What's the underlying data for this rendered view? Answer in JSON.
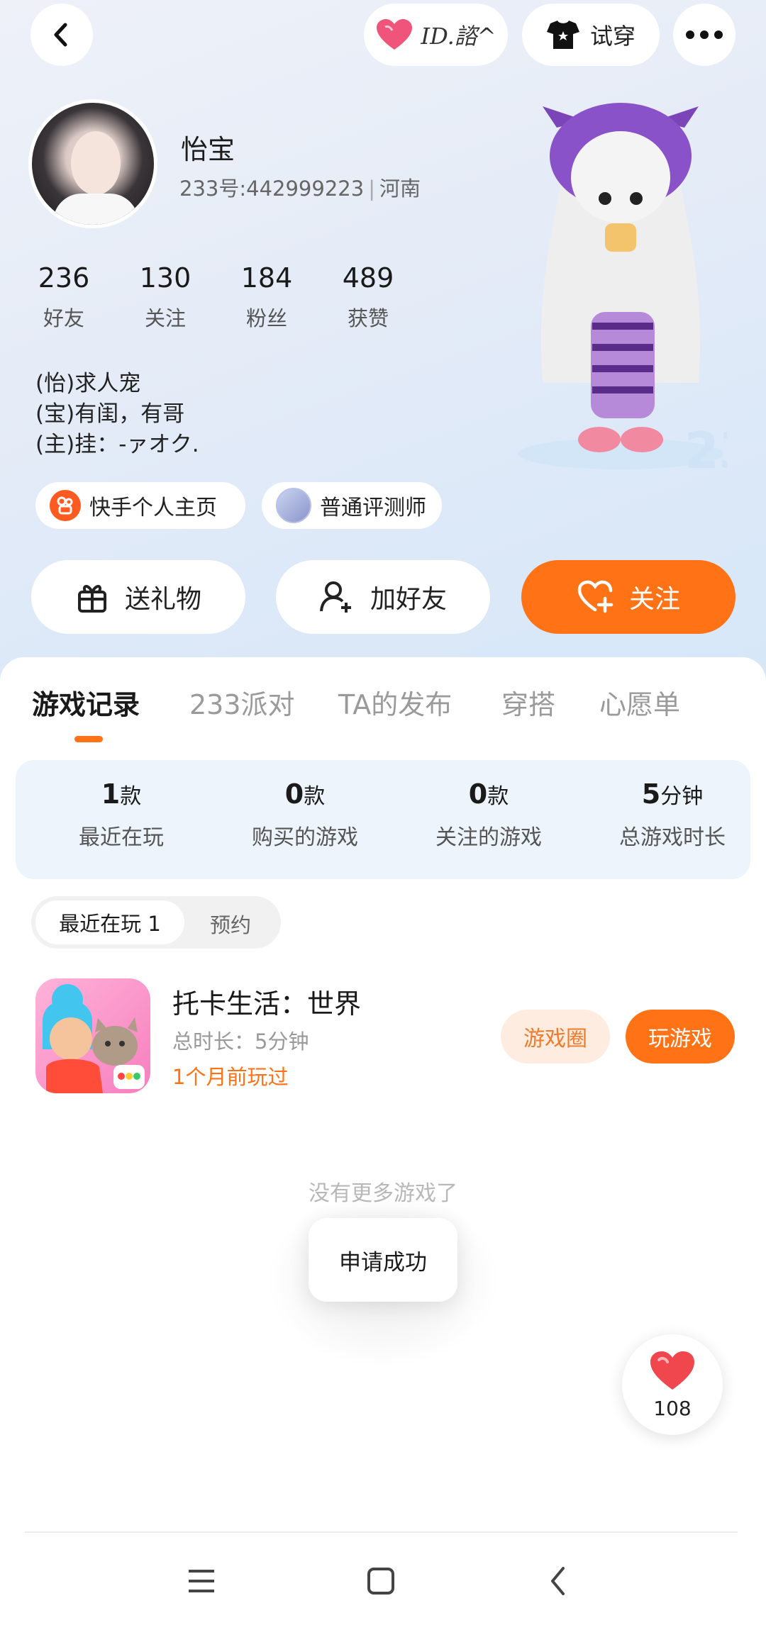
{
  "header": {
    "id_chip_label": "ID.諮^",
    "try_on_label": "试穿"
  },
  "profile": {
    "name": "怡宝",
    "account_id": "233号:442999223",
    "location": "河南",
    "stats": [
      {
        "value": "236",
        "label": "好友"
      },
      {
        "value": "130",
        "label": "关注"
      },
      {
        "value": "184",
        "label": "粉丝"
      },
      {
        "value": "489",
        "label": "获赞"
      }
    ],
    "bio": [
      "(怡)求人宠",
      "(宝)有闺，有哥",
      "(主)挂：-ァオク."
    ],
    "tags": [
      "快手个人主页",
      "普通评测师"
    ]
  },
  "actions": {
    "gift": "送礼物",
    "add_friend": "加好友",
    "follow": "关注"
  },
  "tabs": [
    "游戏记录",
    "233派对",
    "TA的发布",
    "穿搭",
    "心愿单"
  ],
  "game_stats": [
    {
      "value": "1",
      "unit": "款",
      "label": "最近在玩"
    },
    {
      "value": "0",
      "unit": "款",
      "label": "购买的游戏"
    },
    {
      "value": "0",
      "unit": "款",
      "label": "关注的游戏"
    },
    {
      "value": "5",
      "unit": "分钟",
      "label": "总游戏时长"
    }
  ],
  "segment": {
    "active": "最近在玩 1",
    "inactive": "预约"
  },
  "game": {
    "title": "托卡生活：世界",
    "duration": "总时长：5分钟",
    "last_played": "1个月前玩过",
    "circle_button": "游戏圈",
    "play_button": "玩游戏"
  },
  "no_more": "没有更多游戏了",
  "toast": "申请成功",
  "likes_count": "108",
  "colors": {
    "accent": "#ff7215",
    "like_red": "#f0474f"
  }
}
